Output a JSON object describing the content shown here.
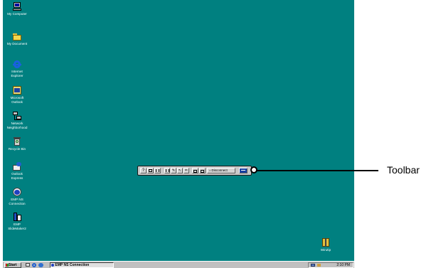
{
  "desktop": {
    "background": "#008080",
    "icons": [
      {
        "label": "My Computer",
        "icon": "computer-icon"
      },
      {
        "label": "My Document",
        "icon": "folder-icon"
      },
      {
        "label": "Internet\nExplorer",
        "icon": "ie-icon"
      },
      {
        "label": "Microsoft\nOutlook",
        "icon": "outlook-icon"
      },
      {
        "label": "Network\nNeighborhood",
        "icon": "network-icon"
      },
      {
        "label": "Recycle Bin",
        "icon": "recycle-bin-icon"
      },
      {
        "label": "Outlook\nExpress",
        "icon": "outlook-express-icon"
      },
      {
        "label": "EMP NS\nConnection",
        "icon": "emp-ns-icon"
      },
      {
        "label": "EMP\nSlideMaker2",
        "icon": "slidemaker-icon"
      }
    ],
    "winzip": {
      "label": "WinZip",
      "icon": "winzip-icon"
    }
  },
  "floating_toolbar": {
    "disconnect_label": "Disconnect"
  },
  "callout": {
    "label": "Toolbar"
  },
  "taskbar": {
    "start_label": "Start",
    "task_label": "EMP NS Connection",
    "clock": "2:10 PM"
  }
}
